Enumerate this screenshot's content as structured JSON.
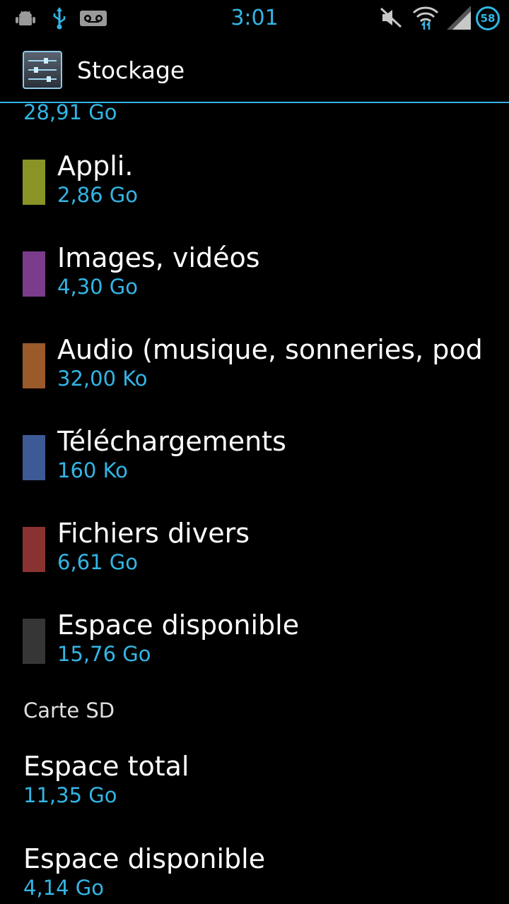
{
  "status_bar": {
    "time": "3:01",
    "battery_level": "58",
    "icons": [
      "android-debug-icon",
      "usb-icon",
      "voicemail-icon",
      "muted-icon",
      "wifi-icon",
      "signal-icon",
      "battery-icon"
    ]
  },
  "action_bar": {
    "title": "Stockage",
    "icon": "settings-sliders-icon"
  },
  "storage": {
    "total_value": "28,91 Go",
    "items": [
      {
        "label": "Appli.",
        "value": "2,86 Go",
        "color": "#8a9426"
      },
      {
        "label": "Images, vidéos",
        "value": "4,30 Go",
        "color": "#7b3c8c"
      },
      {
        "label": "Audio (musique, sonneries, podcasts, etc.)",
        "value": "32,00 Ko",
        "color": "#9a5a2c"
      },
      {
        "label": "Téléchargements",
        "value": "160 Ko",
        "color": "#3e5a96"
      },
      {
        "label": "Fichiers divers",
        "value": "6,61 Go",
        "color": "#8a3232"
      },
      {
        "label": "Espace disponible",
        "value": "15,76 Go",
        "color": "#363636"
      }
    ]
  },
  "sd_card": {
    "header": "Carte SD",
    "items": [
      {
        "label": "Espace total",
        "value": "11,35 Go"
      },
      {
        "label": "Espace disponible",
        "value": "4,14 Go"
      }
    ]
  },
  "colors": {
    "accent": "#33b5e5",
    "background": "#000000"
  }
}
